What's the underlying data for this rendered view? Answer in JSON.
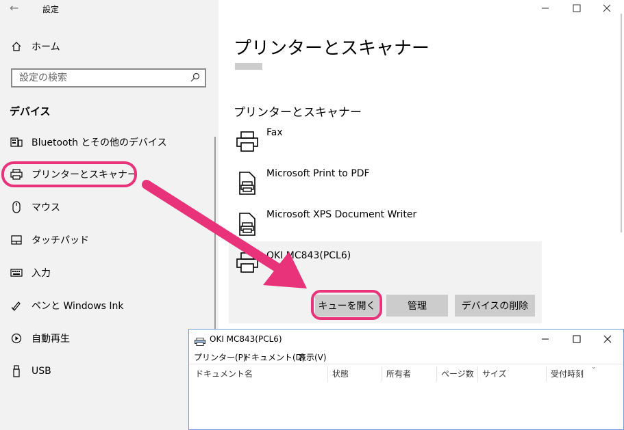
{
  "settings": {
    "title": "設定",
    "window_controls": {
      "minimize": "—",
      "maximize": "☐",
      "close": "✕"
    },
    "sidebar": {
      "home_label": "ホーム",
      "search_placeholder": "設定の検索",
      "section_title": "デバイス",
      "items": [
        {
          "label": "Bluetooth とその他のデバイス",
          "icon": "bluetooth-devices-icon"
        },
        {
          "label": "プリンターとスキャナー",
          "icon": "printer-icon",
          "selected": true
        },
        {
          "label": "マウス",
          "icon": "mouse-icon"
        },
        {
          "label": "タッチパッド",
          "icon": "touchpad-icon"
        },
        {
          "label": "入力",
          "icon": "keyboard-icon"
        },
        {
          "label": "ペンと Windows Ink",
          "icon": "pen-icon"
        },
        {
          "label": "自動再生",
          "icon": "autoplay-icon"
        },
        {
          "label": "USB",
          "icon": "usb-icon"
        }
      ]
    },
    "main": {
      "page_title": "プリンターとスキャナー",
      "section_title": "プリンターとスキャナー",
      "printers": [
        {
          "name": "Fax"
        },
        {
          "name": "Microsoft Print to PDF"
        },
        {
          "name": "Microsoft XPS Document Writer"
        },
        {
          "name": "OKI MC843(PCL6)",
          "selected": true
        }
      ],
      "actions": {
        "open_queue": "キューを開く",
        "manage": "管理",
        "remove": "デバイスの削除"
      }
    }
  },
  "queue_window": {
    "title": "OKI MC843(PCL6)",
    "menu": [
      "プリンター(P)",
      "ドキュメント(D)",
      "表示(V)"
    ],
    "columns": [
      "ドキュメント名",
      "状態",
      "所有者",
      "ページ数",
      "サイズ",
      "受付時刻"
    ]
  },
  "colors": {
    "highlight": "#e8337a",
    "sidebar_bg": "#f2f2f2",
    "button_bg": "#cccccc"
  }
}
